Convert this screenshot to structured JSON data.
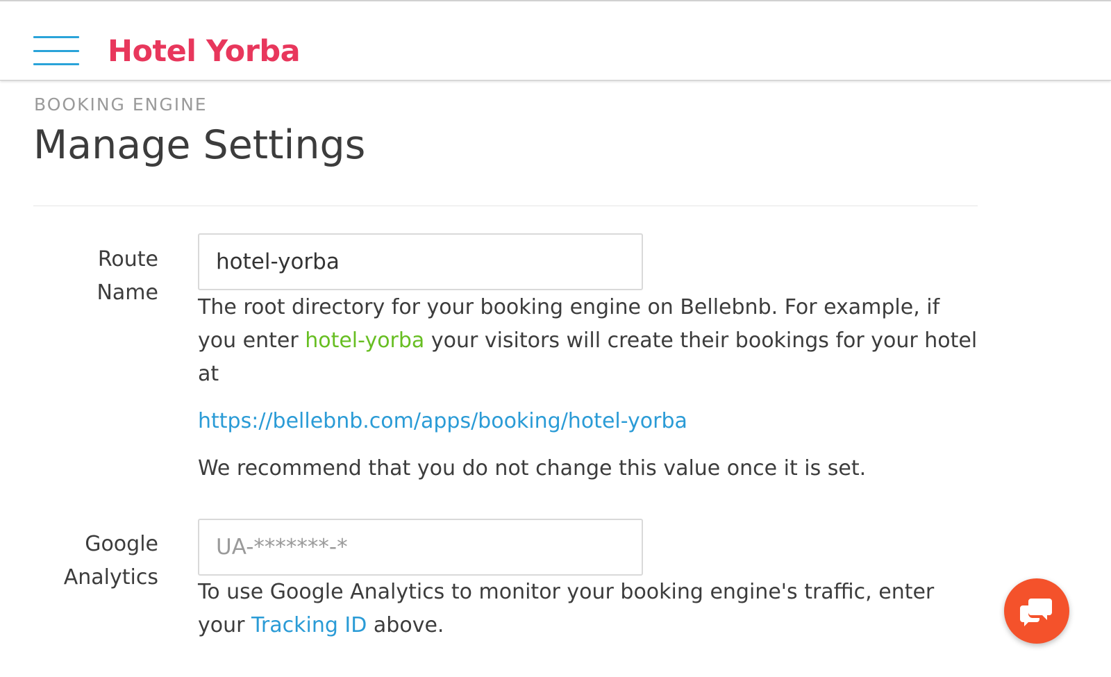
{
  "header": {
    "brand": "Hotel Yorba",
    "menu_icon": "hamburger-menu-icon"
  },
  "page": {
    "eyebrow": "BOOKING ENGINE",
    "title": "Manage Settings"
  },
  "route_name": {
    "label_line1": "Route",
    "label_line2": "Name",
    "value": "hotel-yorba",
    "help_part1": "The root directory for your booking engine on Bellebnb. For example, if you enter ",
    "help_highlight": "hotel-yorba",
    "help_part2": " your visitors will create their bookings for your hotel at",
    "url": "https://bellebnb.com/apps/booking/hotel-yorba",
    "recommendation": "We recommend that you do not change this value once it is set."
  },
  "google_analytics": {
    "label_line1": "Google",
    "label_line2": "Analytics",
    "placeholder": "UA-*******-*",
    "help_part1": "To use Google Analytics to monitor your booking engine's traffic, enter your ",
    "help_link": "Tracking ID",
    "help_part2": " above."
  },
  "chat": {
    "icon": "chat-bubbles-icon"
  },
  "colors": {
    "brand": "#e8375c",
    "menu": "#2aa3d9",
    "highlight": "#67be22",
    "link": "#2a9bd6",
    "chat": "#f4522b"
  }
}
